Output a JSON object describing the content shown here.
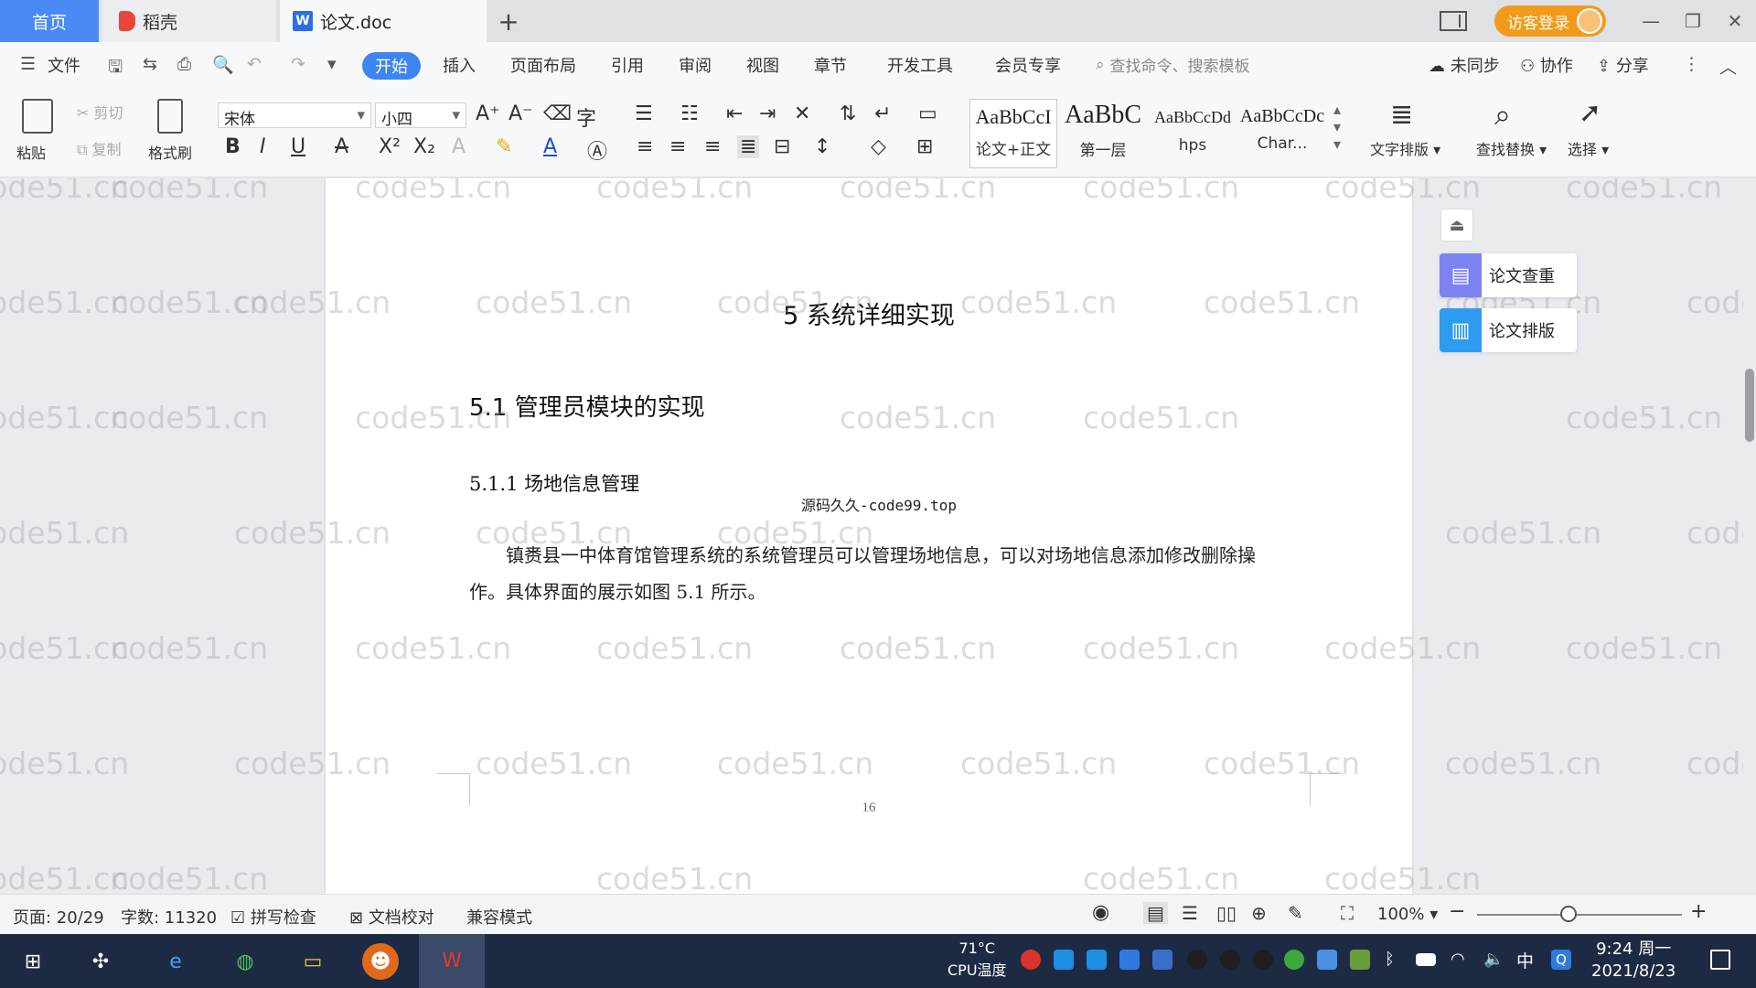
{
  "tabs": {
    "home": "首页",
    "daoke": "稻壳",
    "doc": "论文.doc",
    "add": "+"
  },
  "titlebar": {
    "login": "访客登录",
    "min": "—",
    "restore": "❐",
    "close": "✕"
  },
  "menu": {
    "file": "文件",
    "items": [
      "开始",
      "插入",
      "页面布局",
      "引用",
      "审阅",
      "视图",
      "章节",
      "开发工具",
      "会员专享"
    ],
    "search_placeholder": "查找命令、搜索模板",
    "sync": "未同步",
    "collab": "协作",
    "share": "分享"
  },
  "ribbon": {
    "paste": "粘贴",
    "cut": "剪切",
    "copy": "复制",
    "format_painter": "格式刷",
    "font_name": "宋体",
    "font_size": "小四",
    "styles": [
      {
        "preview": "AaBbCcI",
        "name": "论文+正文"
      },
      {
        "preview": "AaBbC",
        "name": "第一层"
      },
      {
        "preview": "AaBbCcDd",
        "name": "hps"
      },
      {
        "preview": "AaBbCcDc",
        "name": "Char..."
      }
    ],
    "text_layout": "文字排版",
    "find_replace": "查找替换",
    "select": "选择"
  },
  "document": {
    "chapter_title": "5 系统详细实现",
    "section_title": "5.1  管理员模块的实现",
    "subsection_title": "5.1.1  场地信息管理",
    "code_note": "源码久久-code99.top",
    "paragraph": "镇赉县一中体育馆管理系统的系统管理员可以管理场地信息，可以对场地信息添加修改删除操作。具体界面的展示如图 5.1 所示。",
    "page_number": "16",
    "watermark": "code51.cn"
  },
  "side_panel": {
    "check": "论文查重",
    "layout": "论文排版"
  },
  "statusbar": {
    "page": "页面: 20/29",
    "words": "字数: 11320",
    "spell": "拼写检查",
    "proof": "文档校对",
    "compat": "兼容模式",
    "zoom": "100%"
  },
  "taskbar": {
    "cpu_temp": "71°C",
    "cpu_label": "CPU温度",
    "ime": "中",
    "time": "9:24 周一",
    "date": "2021/8/23"
  },
  "colors": {
    "accent": "#3c85f2",
    "login": "#f29b1b",
    "taskbar": "#1d2a44"
  }
}
